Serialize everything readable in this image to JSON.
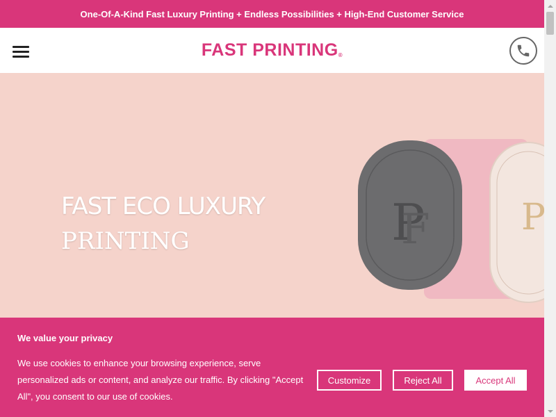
{
  "announcement": "One-Of-A-Kind Fast Luxury Printing + Endless Possibilities + High-End Customer Service",
  "header": {
    "logo_text": "FAST PRINTING",
    "logo_mark": "®",
    "menu_icon": "hamburger-menu-icon",
    "phone_icon": "phone-icon"
  },
  "hero": {
    "title_line1": "FAST ECO LUXURY",
    "title_line2": "PRINTING",
    "background_color": "#f5d3cb"
  },
  "cookie_banner": {
    "title": "We value your privacy",
    "text": "We use cookies to enhance your browsing experience, serve personalized ads or content, and analyze our traffic. By clicking \"Accept All\", you consent to our use of cookies.",
    "buttons": {
      "customize": "Customize",
      "reject": "Reject All",
      "accept": "Accept All"
    }
  },
  "colors": {
    "brand": "#d9367a",
    "hero_bg": "#f5d3cb"
  }
}
